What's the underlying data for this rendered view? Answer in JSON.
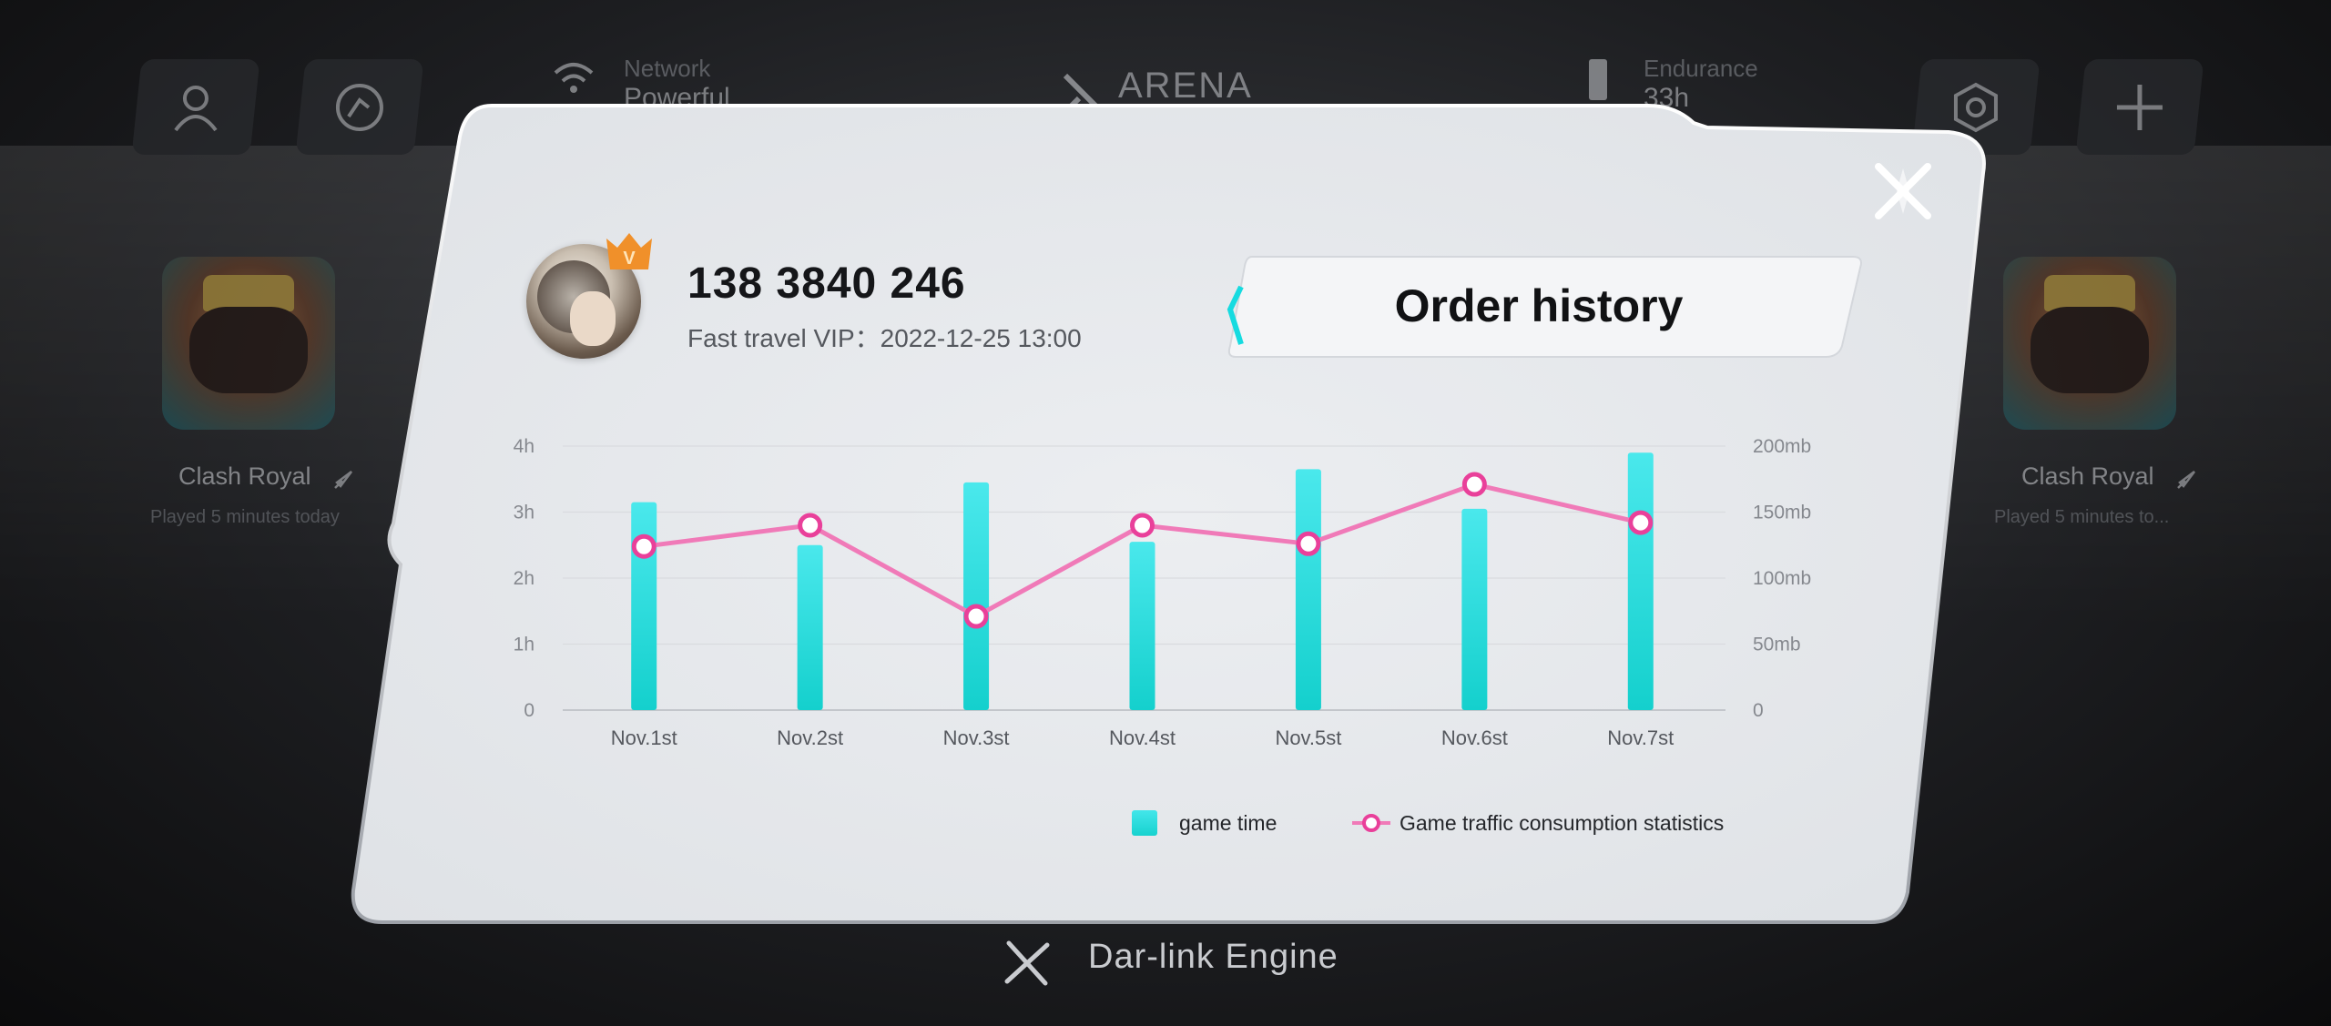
{
  "background": {
    "top_bar": {
      "network": {
        "label": "Network",
        "value": "Powerful"
      },
      "arena_title": "ARENA",
      "endurance": {
        "label": "Endurance",
        "value": "33h"
      }
    },
    "games": [
      {
        "title": "Clash Royal",
        "subtitle": "Played 5 minutes today"
      },
      {
        "title": "Clash Royal",
        "subtitle": "Played 5 minutes to..."
      }
    ],
    "engine": "Dar-link Engine"
  },
  "profile": {
    "phone": "138 3840 246",
    "vip_label": "Fast travel VIP：",
    "vip_expiry": "2022-12-25 13:00",
    "badge": "V"
  },
  "order_button_label": "Order history",
  "colors": {
    "bar": "#1ed6d3",
    "line": "#f07ab8",
    "marker": "#e9409a",
    "accent": "#16dbe0"
  },
  "icons": [
    "user-icon",
    "history-icon",
    "wifi-icon",
    "arena-logo-icon",
    "battery-icon",
    "settings-icon",
    "plus-icon",
    "close-icon",
    "crown-badge-icon",
    "rocket-icon",
    "engine-logo-icon"
  ],
  "chart_data": {
    "type": "bar",
    "categories": [
      "Nov.1st",
      "Nov.2st",
      "Nov.3st",
      "Nov.4st",
      "Nov.5st",
      "Nov.6st",
      "Nov.7st"
    ],
    "left_axis": {
      "ticks": [
        "0",
        "1h",
        "2h",
        "3h",
        "4h"
      ],
      "ylim": [
        0,
        4
      ]
    },
    "right_axis": {
      "ticks": [
        "0",
        "50mb",
        "100mb",
        "150mb",
        "200mb"
      ],
      "ylim": [
        0,
        200
      ]
    },
    "series": [
      {
        "name": "game time",
        "type": "bar",
        "axis": "left",
        "values": [
          3.15,
          2.5,
          3.45,
          2.55,
          3.65,
          3.05,
          3.9
        ]
      },
      {
        "name": "Game traffic consumption statistics",
        "type": "line",
        "axis": "right",
        "values": [
          124,
          140,
          71,
          140,
          126,
          171,
          142
        ]
      }
    ],
    "grid": true,
    "legend": "bottom-right"
  }
}
